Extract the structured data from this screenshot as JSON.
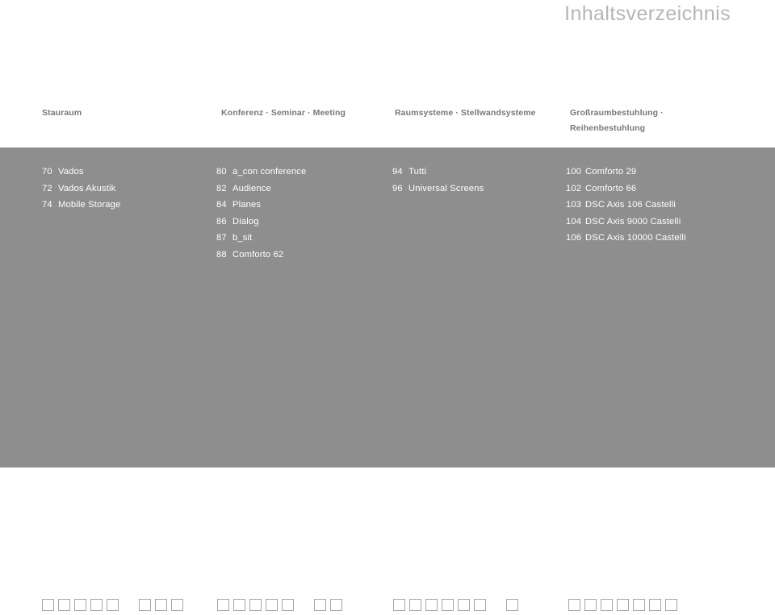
{
  "page": {
    "title": "Inhaltsverzeichnis",
    "panel_color": "#8e8e8e",
    "title_color": "#b6b6b6",
    "header_color": "#77787a",
    "entry_color": "#ffffff"
  },
  "columns": [
    {
      "header_lines": [
        "Stauraum"
      ],
      "entries": [
        {
          "number": "70",
          "label": "Vados"
        },
        {
          "number": "72",
          "label": "Vados Akustik"
        },
        {
          "number": "74",
          "label": "Mobile Storage"
        }
      ],
      "markers": {
        "count": 9,
        "active_index": 5
      }
    },
    {
      "header_lines": [
        "Konferenz · Seminar · Meeting"
      ],
      "entries": [
        {
          "number": "80",
          "label": "a_con conference"
        },
        {
          "number": "82",
          "label": "Audience"
        },
        {
          "number": "84",
          "label": "Planes"
        },
        {
          "number": "86",
          "label": "Dialog"
        },
        {
          "number": "87",
          "label": "b_sit"
        },
        {
          "number": "88",
          "label": "Comforto 62"
        }
      ],
      "markers": {
        "count": 8,
        "active_index": 5
      }
    },
    {
      "header_lines": [
        "Raumsysteme · Stellwandsysteme"
      ],
      "entries": [
        {
          "number": "94",
          "label": "Tutti"
        },
        {
          "number": "96",
          "label": "Universal Screens"
        }
      ],
      "markers": {
        "count": 8,
        "active_index": 6
      }
    },
    {
      "header_lines": [
        "Großraumbestuhlung ·",
        "Reihenbestuhlung"
      ],
      "entries": [
        {
          "number": "100",
          "label": "Comforto 29"
        },
        {
          "number": "102",
          "label": "Comforto 66"
        },
        {
          "number": "103",
          "label": "DSC Axis 106 Castelli"
        },
        {
          "number": "104",
          "label": "DSC Axis 9000 Castelli"
        },
        {
          "number": "106",
          "label": "DSC Axis 10000 Castelli"
        }
      ],
      "markers": {
        "count": 8,
        "active_index": 7
      }
    }
  ]
}
